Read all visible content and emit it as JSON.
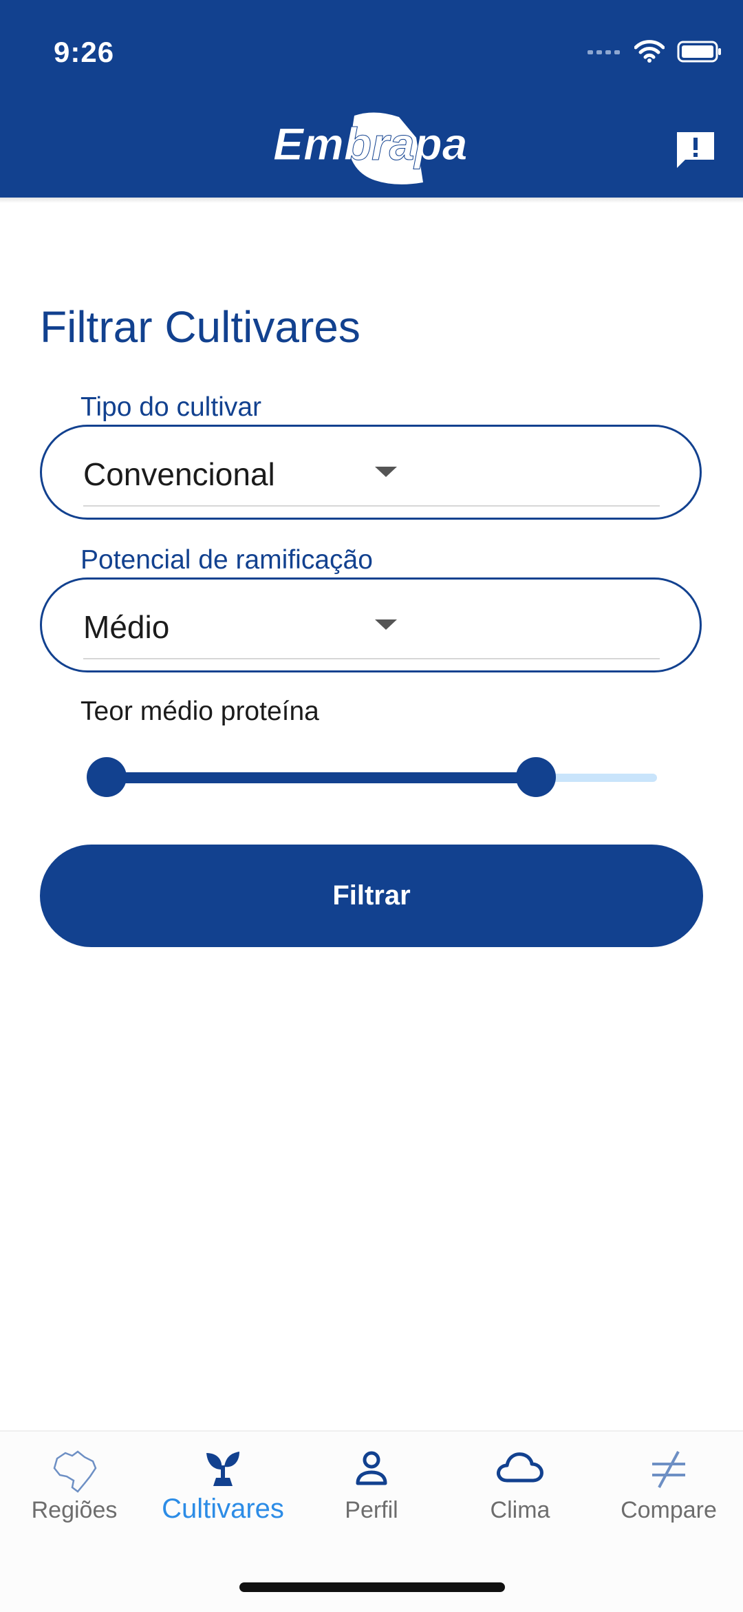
{
  "status_bar": {
    "time": "9:26"
  },
  "header": {
    "logo_text": "Embrapa",
    "brand_color": "#12418f"
  },
  "page": {
    "title": "Filtrar Cultivares"
  },
  "form": {
    "tipo": {
      "label": "Tipo do cultivar",
      "value": "Convencional"
    },
    "ramificacao": {
      "label": "Potencial de ramificação",
      "value": "Médio"
    },
    "proteina": {
      "label": "Teor médio proteína",
      "range_fraction": [
        0.0,
        0.78
      ]
    },
    "submit_label": "Filtrar"
  },
  "bottom_nav": {
    "items": [
      {
        "label": "Regiões",
        "icon": "brazil-map-icon",
        "active": false
      },
      {
        "label": "Cultivares",
        "icon": "sprout-icon",
        "active": true
      },
      {
        "label": "Perfil",
        "icon": "person-icon",
        "active": false
      },
      {
        "label": "Clima",
        "icon": "cloud-icon",
        "active": false
      },
      {
        "label": "Compare",
        "icon": "not-equal-icon",
        "active": false
      }
    ]
  }
}
